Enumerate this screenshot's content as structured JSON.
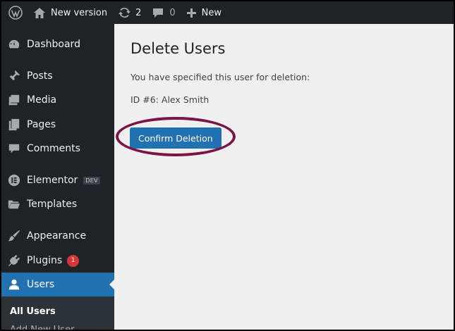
{
  "admin_bar": {
    "site_name": "New version",
    "updates_count": "2",
    "comments_count": "0",
    "new_label": "New"
  },
  "sidebar": {
    "items": [
      {
        "label": "Dashboard",
        "icon": "dashboard-icon"
      },
      {
        "label": "Posts",
        "icon": "pin-icon"
      },
      {
        "label": "Media",
        "icon": "media-icon"
      },
      {
        "label": "Pages",
        "icon": "pages-icon"
      },
      {
        "label": "Comments",
        "icon": "comment-icon"
      },
      {
        "label": "Elementor",
        "icon": "elementor-icon",
        "badge": "DEV"
      },
      {
        "label": "Templates",
        "icon": "folder-icon"
      },
      {
        "label": "Appearance",
        "icon": "brush-icon"
      },
      {
        "label": "Plugins",
        "icon": "plugin-icon",
        "count": "1"
      },
      {
        "label": "Users",
        "icon": "user-icon",
        "current": true
      }
    ],
    "submenu": [
      "All Users",
      "Add New User"
    ]
  },
  "main": {
    "title": "Delete Users",
    "description": "You have specified this user for deletion:",
    "user_line": "ID #6: Alex Smith",
    "confirm_label": "Confirm Deletion"
  },
  "colors": {
    "accent": "#2271b1",
    "sidebar_bg": "#1d2327",
    "highlight_ring": "#7a1546",
    "badge_red": "#d63638"
  }
}
